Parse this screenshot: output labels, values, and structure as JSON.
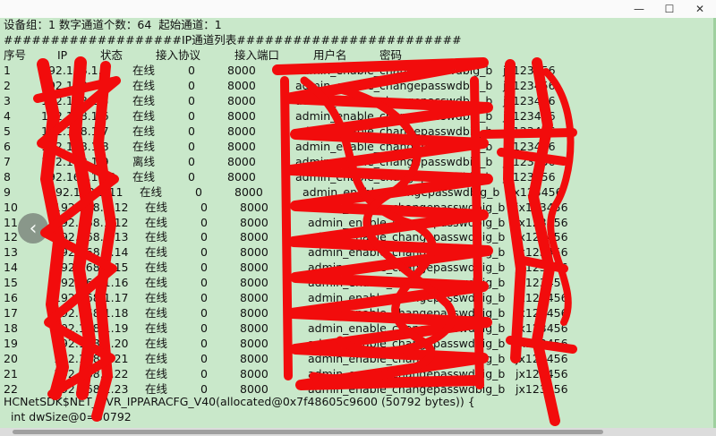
{
  "window": {
    "minimize_glyph": "—",
    "maximize_glyph": "☐",
    "close_glyph": "✕"
  },
  "console": {
    "summary_line": "设备组：1 数字通道个数：64  起始通道：1",
    "section_line": "###################IP通道列表########################",
    "headers": [
      "序号",
      "IP",
      "状态",
      "接入协议",
      "接入端口",
      "用户名",
      "密码"
    ],
    "rows": [
      {
        "no": "1",
        "ip": "192.168.1.3",
        "status": "在线",
        "proto": "0",
        "port": "8000",
        "user": "admin_enable_changepasswdbig_b",
        "pwd": "jx123456"
      },
      {
        "no": "2",
        "ip": "192.168.1.4",
        "status": "在线",
        "proto": "0",
        "port": "8000",
        "user": "admin_enable_changepasswdbig_b",
        "pwd": "jx123456"
      },
      {
        "no": "3",
        "ip": "192.168.1.5",
        "status": "在线",
        "proto": "0",
        "port": "8000",
        "user": "admin_enable_changepasswdbig_b",
        "pwd": "jx123456"
      },
      {
        "no": "4",
        "ip": "192.168.1.6",
        "status": "在线",
        "proto": "0",
        "port": "8000",
        "user": "admin_enable_changepasswdbig_b",
        "pwd": "jx123456"
      },
      {
        "no": "5",
        "ip": "192.168.1.7",
        "status": "在线",
        "proto": "0",
        "port": "8000",
        "user": "admin_enable_changepasswdbig_b",
        "pwd": "jx123456"
      },
      {
        "no": "6",
        "ip": "192.168.1.8",
        "status": "在线",
        "proto": "0",
        "port": "8000",
        "user": "admin_enable_changepasswdbig_b",
        "pwd": "jx123456"
      },
      {
        "no": "7",
        "ip": "192.168.1.9",
        "status": "离线",
        "proto": "0",
        "port": "8000",
        "user": "admin_enable_changepasswdbig_b",
        "pwd": "jx123456"
      },
      {
        "no": "8",
        "ip": "192.168.1.10",
        "status": "在线",
        "proto": "0",
        "port": "8000",
        "user": "admin_enable_changepasswdbig_b",
        "pwd": "jx123456"
      },
      {
        "no": "9",
        "ip": "192.168.1.11",
        "status": "在线",
        "proto": "0",
        "port": "8000",
        "user": "admin_enable_changepasswdbig_b",
        "pwd": "jx123456"
      },
      {
        "no": "10",
        "ip": "192.168.1.12",
        "status": "在线",
        "proto": "0",
        "port": "8000",
        "user": "admin_enable_changepasswdbig_b",
        "pwd": "jx123456"
      },
      {
        "no": "11",
        "ip": "192.168.1.12",
        "status": "在线",
        "proto": "0",
        "port": "8000",
        "user": "admin_enable_changepasswdbig_b",
        "pwd": "jx123456"
      },
      {
        "no": "12",
        "ip": "192.168.1.13",
        "status": "在线",
        "proto": "0",
        "port": "8000",
        "user": "admin_enable_changepasswdbig_b",
        "pwd": "jx123456"
      },
      {
        "no": "13",
        "ip": "192.168.1.14",
        "status": "在线",
        "proto": "0",
        "port": "8000",
        "user": "admin_enable_changepasswdbig_b",
        "pwd": "jx123456"
      },
      {
        "no": "14",
        "ip": "192.168.1.15",
        "status": "在线",
        "proto": "0",
        "port": "8000",
        "user": "admin_enable_changepasswdbig_b",
        "pwd": "jx123456"
      },
      {
        "no": "15",
        "ip": "192.168.1.16",
        "status": "在线",
        "proto": "0",
        "port": "8000",
        "user": "admin_enable_changepasswdbig_b",
        "pwd": "jx123456"
      },
      {
        "no": "16",
        "ip": "192.168.1.17",
        "status": "在线",
        "proto": "0",
        "port": "8000",
        "user": "admin_enable_changepasswdbig_b",
        "pwd": "jx123456"
      },
      {
        "no": "17",
        "ip": "192.168.1.18",
        "status": "在线",
        "proto": "0",
        "port": "8000",
        "user": "admin_enable_changepasswdbig_b",
        "pwd": "jx123456"
      },
      {
        "no": "18",
        "ip": "192.168.1.19",
        "status": "在线",
        "proto": "0",
        "port": "8000",
        "user": "admin_enable_changepasswdbig_b",
        "pwd": "jx123456"
      },
      {
        "no": "19",
        "ip": "192.168.1.20",
        "status": "在线",
        "proto": "0",
        "port": "8000",
        "user": "admin_enable_changepasswdbig_b",
        "pwd": "jx123456"
      },
      {
        "no": "20",
        "ip": "192.168.1.21",
        "status": "在线",
        "proto": "0",
        "port": "8000",
        "user": "admin_enable_changepasswdbig_b",
        "pwd": "jx123456"
      },
      {
        "no": "21",
        "ip": "192.168.1.22",
        "status": "在线",
        "proto": "0",
        "port": "8000",
        "user": "admin_enable_changepasswdbig_b",
        "pwd": "jx123456"
      },
      {
        "no": "22",
        "ip": "192.168.1.23",
        "status": "在线",
        "proto": "0",
        "port": "8000",
        "user": "admin_enable_changepasswdbig_b",
        "pwd": "jx123456"
      }
    ],
    "footer_line_1": "HCNetSDK$NET_DVR_IPPARACFG_V40(allocated@0x7f48605c9600 (50792 bytes)) {",
    "footer_line_2": "  int dwSize@0=50792"
  },
  "colors": {
    "console_bg": "#c9e8ca",
    "redaction": "#f20c0c"
  },
  "icons": {
    "nav_prev": "chevron-left-icon"
  }
}
